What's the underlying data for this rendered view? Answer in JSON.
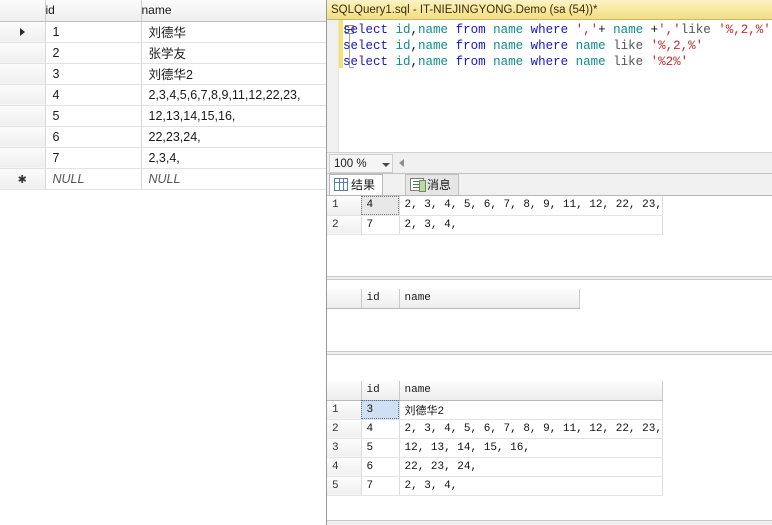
{
  "left_table": {
    "columns": [
      "",
      "id",
      "name"
    ],
    "rows": [
      {
        "marker": "arrow",
        "id": "1",
        "name": "刘德华",
        "null": false
      },
      {
        "marker": "",
        "id": "2",
        "name": "张学友",
        "null": false
      },
      {
        "marker": "",
        "id": "3",
        "name": "刘德华2",
        "null": false
      },
      {
        "marker": "",
        "id": "4",
        "name": "2,3,4,5,6,7,8,9,11,12,22,23,",
        "null": false
      },
      {
        "marker": "",
        "id": "5",
        "name": "12,13,14,15,16,",
        "null": false
      },
      {
        "marker": "",
        "id": "6",
        "name": "22,23,24,",
        "null": false
      },
      {
        "marker": "",
        "id": "7",
        "name": "2,3,4,",
        "null": false
      },
      {
        "marker": "star",
        "id": "NULL",
        "name": "NULL",
        "null": true
      }
    ]
  },
  "editor": {
    "tab_title": "SQLQuery1.sql - IT-NIEJINGYONG.Demo (sa (54))*",
    "lines": [
      [
        {
          "t": "select ",
          "c": "kw"
        },
        {
          "t": "id",
          "c": "ident"
        },
        {
          "t": ",",
          "c": "plain"
        },
        {
          "t": "name ",
          "c": "ident"
        },
        {
          "t": "from ",
          "c": "kw"
        },
        {
          "t": "name ",
          "c": "ident"
        },
        {
          "t": "where ",
          "c": "kw"
        },
        {
          "t": "','",
          "c": "str"
        },
        {
          "t": "+ ",
          "c": "plain"
        },
        {
          "t": "name ",
          "c": "ident"
        },
        {
          "t": "+",
          "c": "plain"
        },
        {
          "t": "','",
          "c": "str"
        },
        {
          "t": "like ",
          "c": "op"
        },
        {
          "t": "'%,2,%'",
          "c": "str"
        }
      ],
      [
        {
          "t": "select ",
          "c": "kw"
        },
        {
          "t": "id",
          "c": "ident"
        },
        {
          "t": ",",
          "c": "plain"
        },
        {
          "t": "name ",
          "c": "ident"
        },
        {
          "t": "from ",
          "c": "kw"
        },
        {
          "t": "name ",
          "c": "ident"
        },
        {
          "t": "where ",
          "c": "kw"
        },
        {
          "t": "name ",
          "c": "ident"
        },
        {
          "t": "like ",
          "c": "op"
        },
        {
          "t": "'%,2,%'",
          "c": "str"
        }
      ],
      [
        {
          "t": "select ",
          "c": "kw"
        },
        {
          "t": "id",
          "c": "ident"
        },
        {
          "t": ",",
          "c": "plain"
        },
        {
          "t": "name ",
          "c": "ident"
        },
        {
          "t": "from ",
          "c": "kw"
        },
        {
          "t": "name ",
          "c": "ident"
        },
        {
          "t": "where ",
          "c": "kw"
        },
        {
          "t": "name ",
          "c": "ident"
        },
        {
          "t": "like ",
          "c": "op"
        },
        {
          "t": "'%2%'",
          "c": "str"
        }
      ]
    ]
  },
  "zoombar": {
    "zoom_value": "100 %"
  },
  "results_tabs": [
    {
      "label": "结果",
      "icon": "grid-icon",
      "active": true
    },
    {
      "label": "消息",
      "icon": "message-icon",
      "active": false
    }
  ],
  "result_sets": [
    {
      "show_header": false,
      "columns": [
        "",
        "id",
        "name"
      ],
      "rows": [
        {
          "n": "1",
          "id": "4",
          "name": "2, 3, 4, 5, 6, 7, 8, 9, 11, 12, 22, 23,",
          "selected": true
        },
        {
          "n": "2",
          "id": "7",
          "name": "2, 3, 4,",
          "selected": false
        }
      ]
    },
    {
      "show_header": true,
      "columns": [
        "",
        "id",
        "name"
      ],
      "rows": []
    },
    {
      "show_header": true,
      "columns": [
        "",
        "id",
        "name"
      ],
      "rows": [
        {
          "n": "1",
          "id": "3",
          "name": "刘德华2",
          "cjk": true,
          "selected": true
        },
        {
          "n": "2",
          "id": "4",
          "name": "2, 3, 4, 5, 6, 7, 8, 9, 11, 12, 22, 23,",
          "cjk": false,
          "selected": false
        },
        {
          "n": "3",
          "id": "5",
          "name": "12, 13, 14, 15, 16,",
          "cjk": false,
          "selected": false
        },
        {
          "n": "4",
          "id": "6",
          "name": "22, 23, 24,",
          "cjk": false,
          "selected": false
        },
        {
          "n": "5",
          "id": "7",
          "name": "2, 3, 4,",
          "cjk": false,
          "selected": false
        }
      ]
    }
  ],
  "colors": {
    "tab_yellow": "#f7e79c",
    "keyword_blue": "#1818c8",
    "identifier_teal": "#0f8c8c",
    "string_red": "#c42b2b",
    "selection_blue": "#cfe0f5"
  }
}
